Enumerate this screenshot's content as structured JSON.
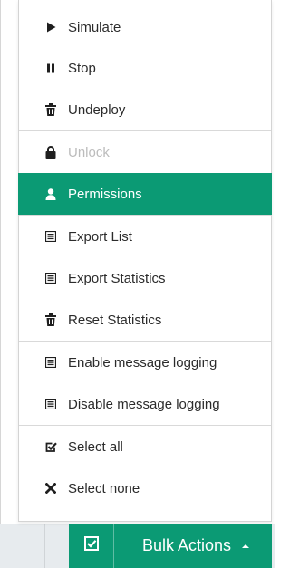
{
  "menu": {
    "groups": [
      {
        "items": [
          {
            "label": "Simulate",
            "icon": "play-icon"
          },
          {
            "label": "Stop",
            "icon": "pause-icon"
          },
          {
            "label": "Undeploy",
            "icon": "trash-icon"
          }
        ]
      },
      {
        "items": [
          {
            "label": "Unlock",
            "icon": "lock-icon",
            "state": "disabled"
          },
          {
            "label": "Permissions",
            "icon": "user-icon",
            "state": "active"
          }
        ]
      },
      {
        "items": [
          {
            "label": "Export List",
            "icon": "list-icon"
          },
          {
            "label": "Export Statistics",
            "icon": "list-icon"
          },
          {
            "label": "Reset Statistics",
            "icon": "trash-icon"
          }
        ]
      },
      {
        "items": [
          {
            "label": "Enable message logging",
            "icon": "list-icon"
          },
          {
            "label": "Disable message logging",
            "icon": "list-icon"
          }
        ]
      },
      {
        "items": [
          {
            "label": "Select all",
            "icon": "checkbox-checked-icon"
          },
          {
            "label": "Select none",
            "icon": "close-x-icon"
          }
        ]
      }
    ]
  },
  "bulk_actions": {
    "label": "Bulk Actions",
    "checkbox_icon": "checkbox-checked-icon",
    "caret_icon": "caret-up-icon"
  },
  "colors": {
    "accent": "#0b9a74",
    "text": "#2b2b2b",
    "disabled": "#bcbcbc",
    "divider": "#d9d9d9",
    "strip": "#e7ebee"
  }
}
